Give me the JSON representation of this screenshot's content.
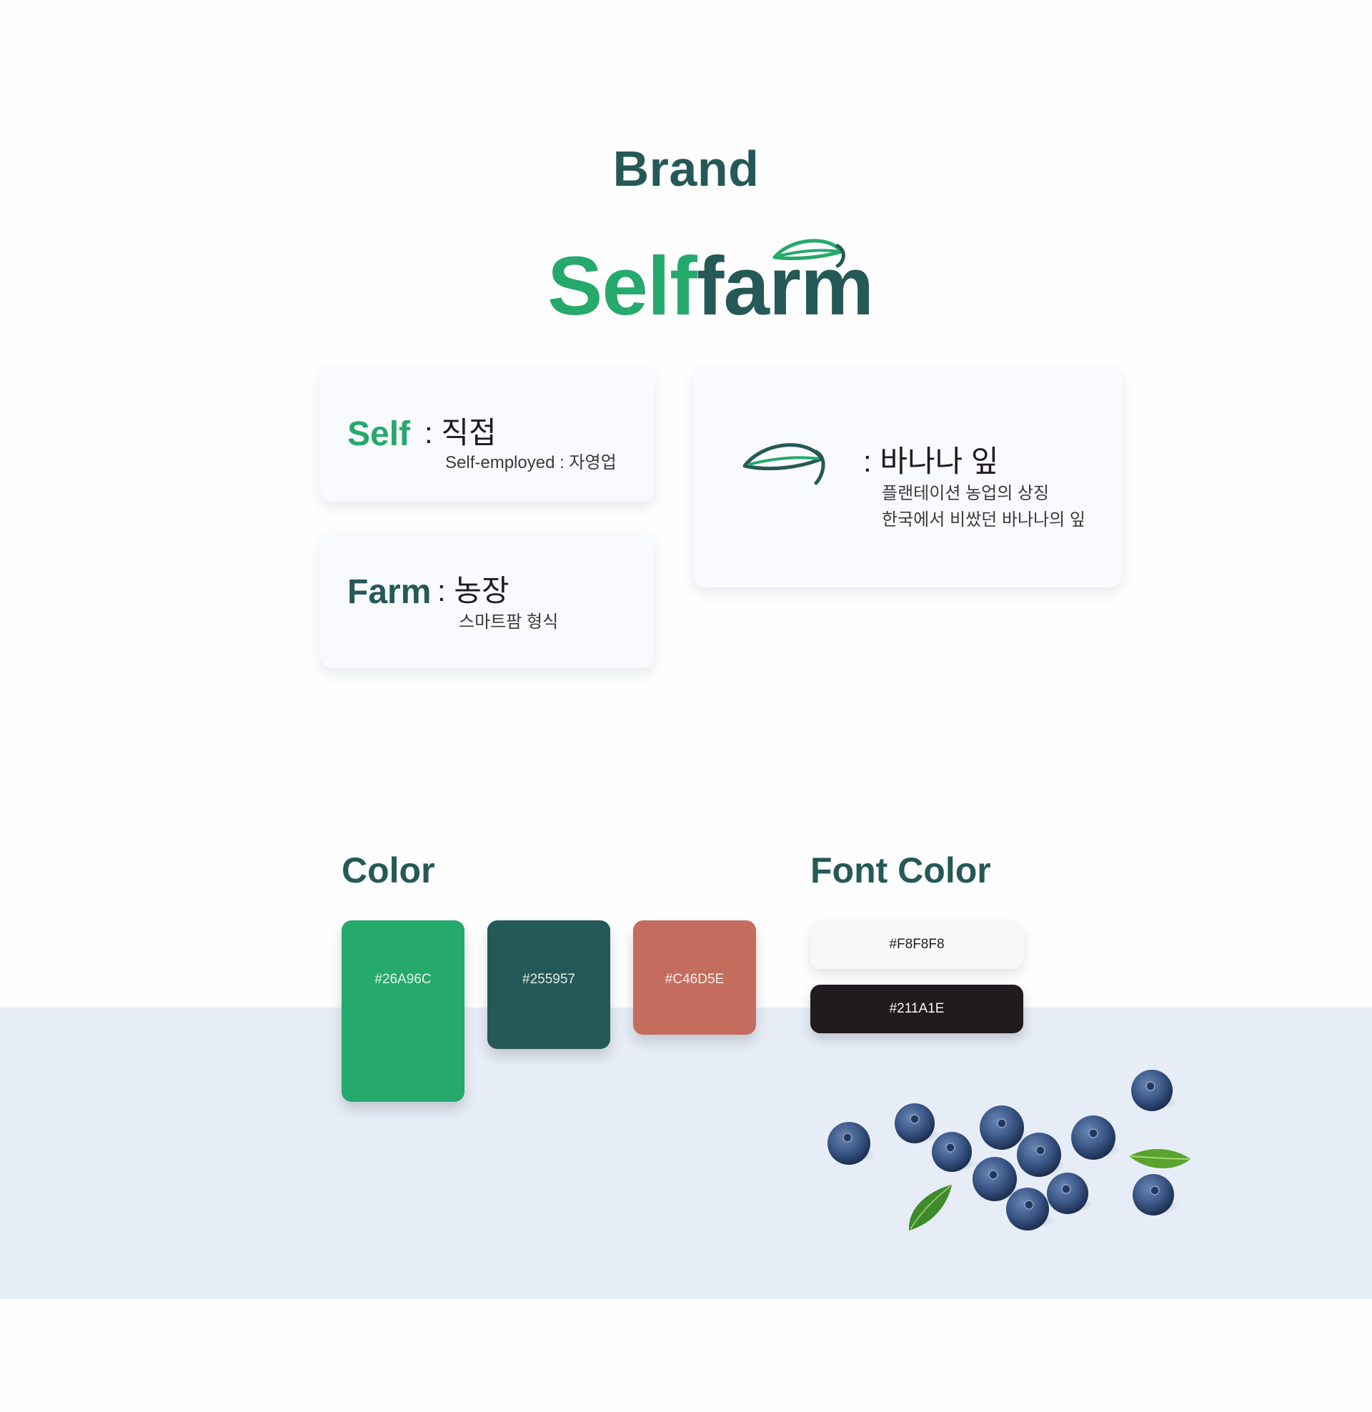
{
  "brand": {
    "title": "Brand",
    "logo": {
      "part_self": "Self",
      "part_farm": "farm",
      "leaf_icon": "leaf-icon"
    }
  },
  "meaning": {
    "self": {
      "term": "Self",
      "colon_ko": ": 직접",
      "sub": "Self-employed : 자영업"
    },
    "farm": {
      "term": "Farm",
      "colon_ko": ": 농장",
      "sub": "스마트팜 형식"
    },
    "leaf": {
      "icon": "leaf-icon",
      "title": ": 바나나 잎",
      "line1": "플랜테이션 농업의 상징",
      "line2": "한국에서 비쌌던 바나나의 잎"
    }
  },
  "colors": {
    "title": "Color",
    "swatches": [
      {
        "hex": "#26A96C",
        "label": "#26A96C"
      },
      {
        "hex": "#255957",
        "label": "#255957"
      },
      {
        "hex": "#C46D5E",
        "label": "#C46D5E"
      }
    ]
  },
  "font_colors": {
    "title": "Font Color",
    "swatches": [
      {
        "hex": "#F8F8F8",
        "label": "#F8F8F8"
      },
      {
        "hex": "#211A1E",
        "label": "#211A1E"
      }
    ]
  },
  "decoration": {
    "image": "blueberries-photo"
  }
}
